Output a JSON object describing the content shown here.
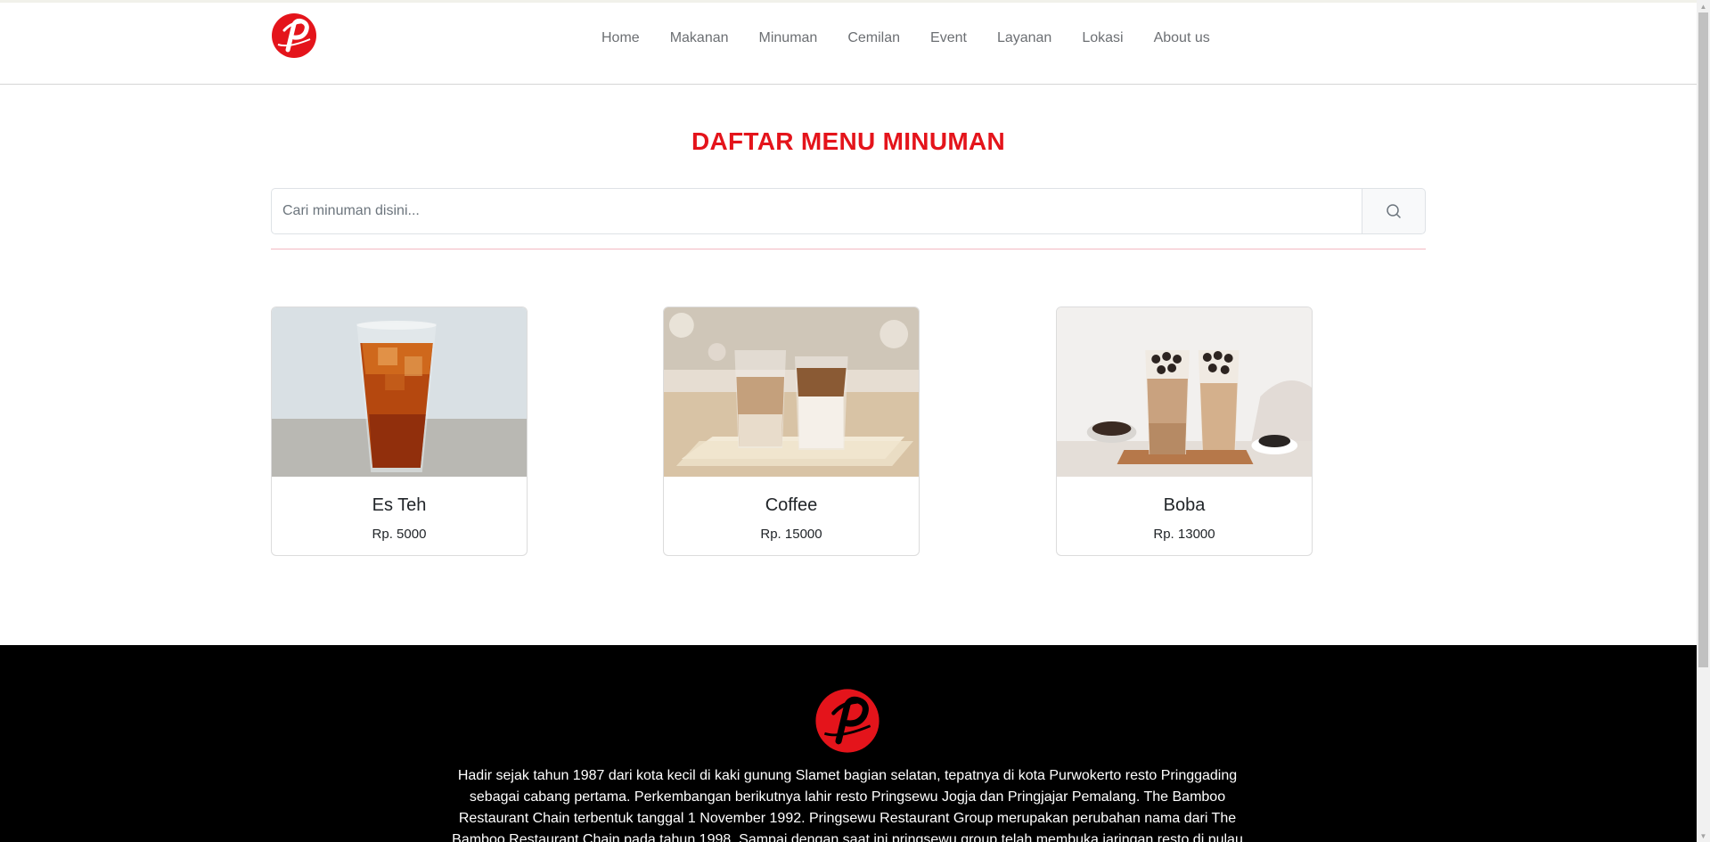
{
  "brand": {
    "logo_letter": "p",
    "logo_color": "#e4141b"
  },
  "nav": [
    {
      "label": "Home",
      "name": "nav-home"
    },
    {
      "label": "Makanan",
      "name": "nav-makanan"
    },
    {
      "label": "Minuman",
      "name": "nav-minuman"
    },
    {
      "label": "Cemilan",
      "name": "nav-cemilan"
    },
    {
      "label": "Event",
      "name": "nav-event"
    },
    {
      "label": "Layanan",
      "name": "nav-layanan"
    },
    {
      "label": "Lokasi",
      "name": "nav-lokasi"
    },
    {
      "label": "About us",
      "name": "nav-about-us"
    }
  ],
  "main": {
    "title": "DAFTAR MENU MINUMAN",
    "search": {
      "placeholder": "Cari minuman disini...",
      "value": "",
      "icon": "search-icon"
    }
  },
  "products": [
    {
      "name": "Es Teh",
      "price": "Rp. 5000",
      "image": "iced-tea-photo"
    },
    {
      "name": "Coffee",
      "price": "Rp. 15000",
      "image": "iced-coffee-photo"
    },
    {
      "name": "Boba",
      "price": "Rp. 13000",
      "image": "boba-tea-photo"
    }
  ],
  "footer": {
    "about_text": "Hadir sejak tahun 1987 dari kota kecil di kaki gunung Slamet bagian selatan, tepatnya di kota Purwokerto resto Pringgading sebagai cabang pertama. Perkembangan berikutnya lahir resto Pringsewu Jogja dan Pringjajar Pemalang. The Bamboo Restaurant Chain terbentuk tanggal 1 November 1992. Pringsewu Restaurant Group merupakan perubahan nama dari The Bamboo Restaurant Chain pada tahun 1998. Sampai dengan saat ini pringsewu group telah membuka jaringan resto di pulau"
  },
  "colors": {
    "accent": "#e4141b",
    "nav_text": "#6c6f73",
    "footer_bg": "#000000"
  }
}
